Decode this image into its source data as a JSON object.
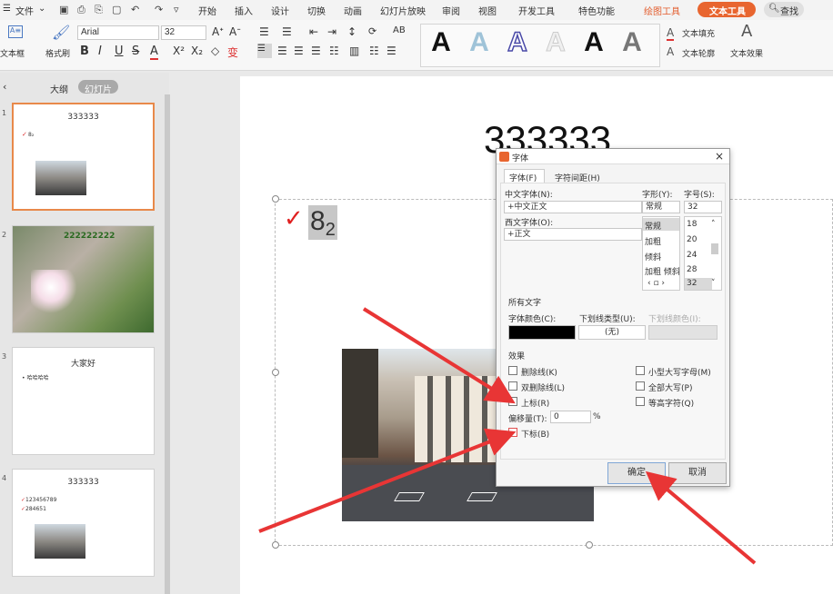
{
  "menu": {
    "file": "文件",
    "items": [
      "开始",
      "插入",
      "设计",
      "切换",
      "动画",
      "幻灯片放映",
      "审阅",
      "视图",
      "开发工具",
      "特色功能"
    ],
    "drawing_tools": "绘图工具",
    "text_tools": "文本工具",
    "search": "查找"
  },
  "ribbon": {
    "textbox": "文本框",
    "format_painter": "格式刷",
    "font": "Arial",
    "size": "32",
    "text_fill": "文本填充",
    "text_outline": "文本轮廓",
    "text_effect": "文本效果"
  },
  "panel": {
    "tab_outline": "大纲",
    "tab_slides": "幻灯片"
  },
  "slides": [
    {
      "num": "1",
      "title": "333333",
      "sub": "8₂"
    },
    {
      "num": "2",
      "title": "222222222"
    },
    {
      "num": "3",
      "title": "大家好",
      "sub": "哈哈哈哈"
    },
    {
      "num": "4",
      "title": "333333",
      "line1": "123456789",
      "line2": "284651"
    }
  ],
  "slide": {
    "title": "333333",
    "base": "8",
    "subscript": "2",
    "check": "✓"
  },
  "dialog": {
    "title": "字体",
    "close": "×",
    "tab_font": "字体(F)",
    "tab_spacing": "字符间距(H)",
    "cn_font_label": "中文字体(N):",
    "cn_font": "+中文正文",
    "west_font_label": "西文字体(O):",
    "west_font": "+正文",
    "style_label": "字形(Y):",
    "size_label": "字号(S):",
    "style_value": "常规",
    "size_value": "32",
    "styles": [
      "常规",
      "加粗",
      "倾斜",
      "加粗 倾斜"
    ],
    "sizes": [
      "18",
      "20",
      "24",
      "28",
      "32"
    ],
    "all_text": "所有文字",
    "font_color": "字体颜色(C):",
    "underline_type": "下划线类型(U):",
    "underline_value": "(无)",
    "underline_color": "下划线颜色(I):",
    "effects": "效果",
    "strike": "删除线(K)",
    "double_strike": "双删除线(L)",
    "superscript": "上标(R)",
    "small_caps": "小型大写字母(M)",
    "all_caps": "全部大写(P)",
    "equal_height": "等高字符(Q)",
    "offset_label": "偏移量(T):",
    "offset_value": "0",
    "percent": "%",
    "subscript": "下标(B)",
    "ok": "确定",
    "cancel": "取消"
  }
}
